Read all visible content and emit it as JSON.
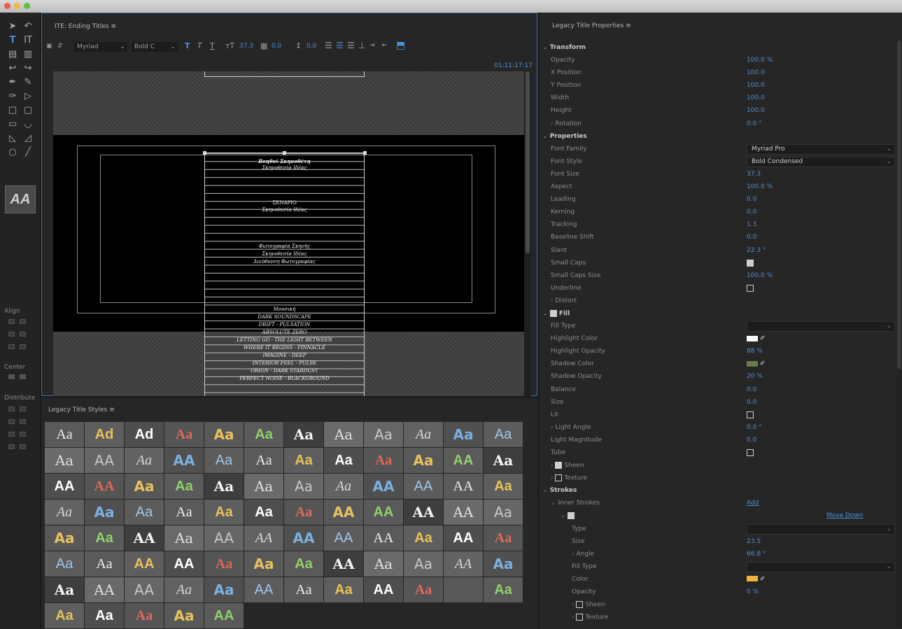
{
  "window": {
    "traffic_lights": [
      "#ee5b52",
      "#f4b73f",
      "#5cc23c"
    ]
  },
  "titler": {
    "tab_title": "ITE: Ending Titles",
    "font_family": "Myriad",
    "font_style": "Bold C",
    "font_size": "37.3",
    "kerning": "0.0",
    "leading": "0.0",
    "timecode": "01:11:17:17"
  },
  "credits": [
    "Βοηθοί Σκηνοθέτη",
    "Σκηνοθεσία Ιδέας",
    "ΣΕΝΑΡΙΟ",
    "Σκηνοθεσία Ιδέας",
    "Φωτογραφία Σκηνής",
    "Σκηνοθεσία Ιδέας",
    "Διεύθυνση Φωτογραφίας",
    "Μουσική",
    "DARK SOUNDSCAPE",
    "DRIFT - PULSATION",
    "ABSOLUTE ZERO",
    "LETTING GO - THE LIGHT BETWEEN",
    "WHERE IT BEGINS - PINNACLE",
    "IMAGINE - DEEP",
    "INTERIOR FEEL - PULSE",
    "ORION - DARK STARDUST",
    "PERFECT NOISE - BLACKGROUND"
  ],
  "left_tools": {
    "align_label": "Align",
    "center_label": "Center",
    "distribute_label": "Distribute",
    "style_tool_label": "AA"
  },
  "styles_panel": {
    "title": "Legacy Title Styles",
    "swatches": [
      "Aa",
      "Ad",
      "Ad",
      "Aa",
      "Aa",
      "Aa",
      "Aa",
      "Aa",
      "Aa",
      "Aa",
      "Aa",
      "Aa",
      "Aa",
      "AA",
      "Aa",
      "AA",
      "Aa",
      "Aa",
      "Aa",
      "Aa",
      "Aa",
      "Aa",
      "AA",
      "Aa",
      "AA",
      "AA",
      "Aa",
      "Aa",
      "Aa",
      "Aa",
      "Aa",
      "Aa",
      "AA",
      "AA",
      "AA",
      "Aa",
      "Aa",
      "Aa",
      "Aa",
      "Aa",
      "Aa",
      "Aa",
      "Aa",
      "AA",
      "AA",
      "AA",
      "AA",
      "Aa",
      "Aa",
      "Aa",
      "AA",
      "Aa",
      "AA",
      "AA",
      "AA",
      "AA",
      "AA",
      "Aa",
      "AA",
      "Aa",
      "Aa",
      "Aa",
      "AA",
      "AA",
      "Aa",
      "Aa",
      "Aa",
      "AA",
      "Aa",
      "Aa",
      "AA",
      "Aa",
      "Aa",
      "AA",
      "AA",
      "Aa",
      "Aa",
      "AA",
      "Aa",
      "Aa",
      "AA",
      "Aa",
      "",
      "Aa",
      "Aa",
      "Aa",
      "Aa",
      "Aa",
      "AA"
    ]
  },
  "properties_panel": {
    "title": "Legacy Title Properties",
    "transform": {
      "header": "Transform",
      "opacity_label": "Opacity",
      "opacity": "100.0 %",
      "x_label": "X Position",
      "x": "100.0",
      "y_label": "Y Position",
      "y": "100.0",
      "width_label": "Width",
      "width": "100.0",
      "height_label": "Height",
      "height": "100.0",
      "rotation_label": "Rotation",
      "rotation": "0.0 °"
    },
    "properties": {
      "header": "Properties",
      "font_family_label": "Font Family",
      "font_family": "Myriad Pro",
      "font_style_label": "Font Style",
      "font_style": "Bold Condensed",
      "font_size_label": "Font Size",
      "font_size": "37.3",
      "aspect_label": "Aspect",
      "aspect": "100.0 %",
      "leading_label": "Leading",
      "leading": "0.0",
      "kerning_label": "Kerning",
      "kerning": "0.0",
      "tracking_label": "Tracking",
      "tracking": "1.3",
      "baseline_label": "Baseline Shift",
      "baseline": "0.0",
      "slant_label": "Slant",
      "slant": "22.3 °",
      "small_caps_label": "Small Caps",
      "small_caps_size_label": "Small Caps Size",
      "small_caps_size": "100.0 %",
      "underline_label": "Underline",
      "distort_label": "Distort"
    },
    "fill": {
      "header": "Fill",
      "fill_type_label": "Fill Type",
      "highlight_color_label": "Highlight Color",
      "highlight_opacity_label": "Highlight Opacity",
      "highlight_opacity": "88 %",
      "shadow_color_label": "Shadow Color",
      "shadow_opacity_label": "Shadow Opacity",
      "shadow_opacity": "20 %",
      "balance_label": "Balance",
      "balance": "0.0",
      "size_label": "Size",
      "size": "0.0",
      "lit_label": "Lit",
      "light_angle_label": "Light Angle",
      "light_angle": "0.0 °",
      "light_magnitude_label": "Light Magnitude",
      "light_magnitude": "0.0",
      "tube_label": "Tube",
      "sheen_label": "Sheen",
      "texture_label": "Texture"
    },
    "strokes": {
      "header": "Strokes",
      "inner_label": "Inner Strokes",
      "add_label": "Add",
      "move_down_label": "Move Down",
      "type_label": "Type",
      "size_label": "Size",
      "size": "23.5",
      "angle_label": "Angle",
      "angle": "66.8 °",
      "fill_type_label": "Fill Type",
      "color_label": "Color",
      "opacity_label": "Opacity",
      "opacity": "0 %",
      "sheen_label": "Sheen",
      "texture_label": "Texture"
    }
  },
  "colors": {
    "accent": "#4a90d9",
    "highlight_color": "#ffffff",
    "shadow_color": "#6a7a4a",
    "stroke_color": "#f0b43c"
  }
}
